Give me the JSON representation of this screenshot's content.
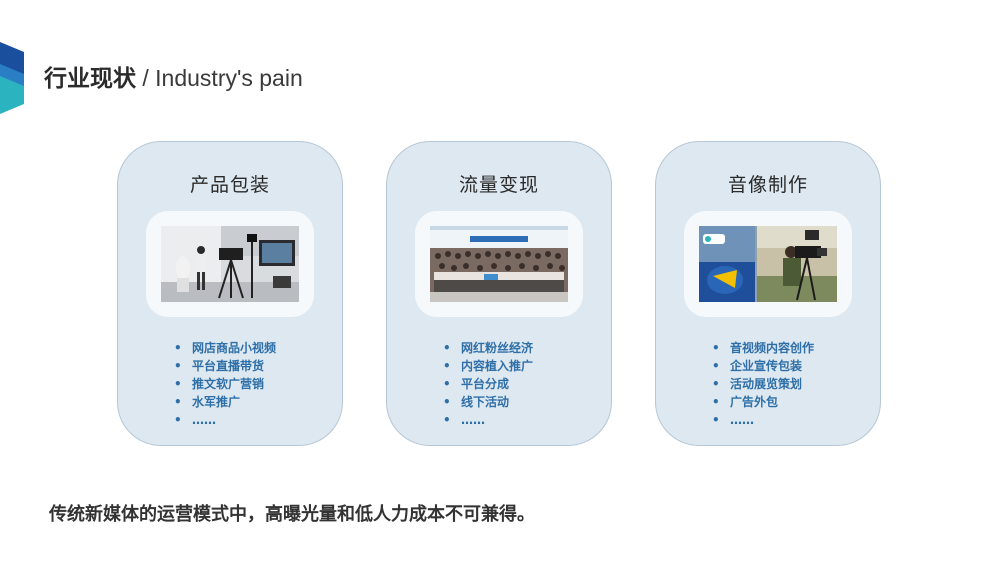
{
  "title": {
    "cn": "行业现状",
    "en": " / Industry's pain"
  },
  "cards": [
    {
      "title": "产品包装",
      "items": [
        "网店商品小视频",
        "平台直播带货",
        "推文软广营销",
        "水军推广",
        "……"
      ]
    },
    {
      "title": "流量变现",
      "items": [
        "网红粉丝经济",
        "内容植入推广",
        "平台分成",
        "线下活动",
        "……"
      ]
    },
    {
      "title": "音像制作",
      "items": [
        "音视频内容创作",
        "企业宣传包装",
        "活动展览策划",
        "广告外包",
        "……"
      ]
    }
  ],
  "bullet_char": "•",
  "footer": "传统新媒体的运营模式中，高曝光量和低人力成本不可兼得。",
  "colors": {
    "card_bg": "#dde8f1",
    "card_border": "#b6c7d6",
    "bullet_text": "#2f6fa8",
    "logo_blue": "#1a5aa8",
    "logo_teal": "#2bb3c0"
  }
}
